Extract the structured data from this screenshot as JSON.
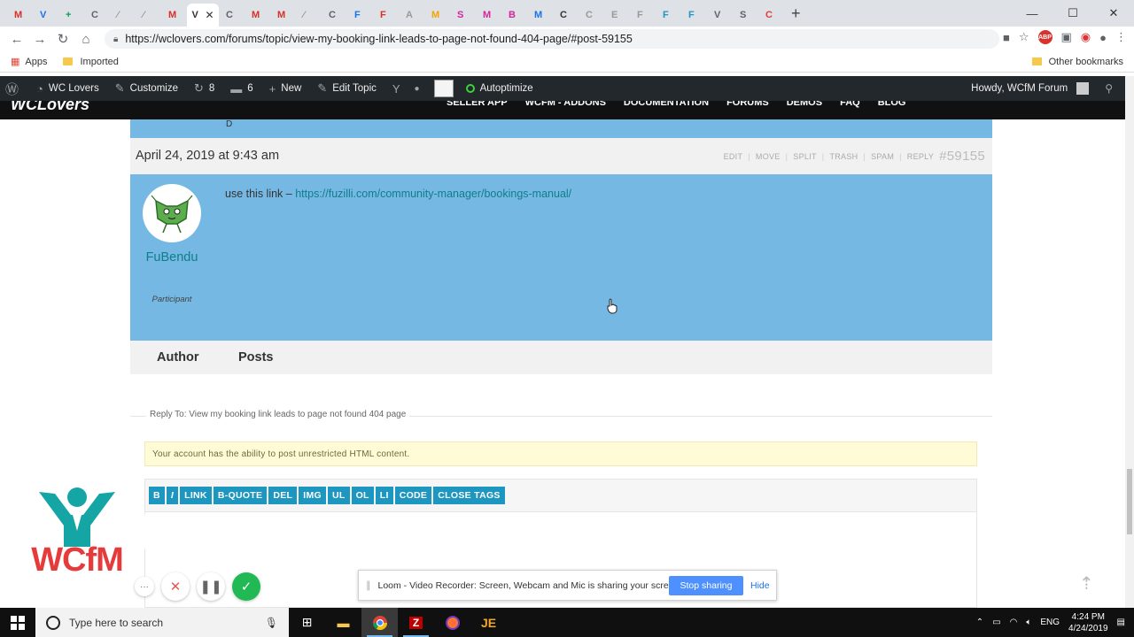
{
  "browser": {
    "url": "https://wclovers.com/forums/topic/view-my-booking-link-leads-to-page-not-found-404-page/#post-59155",
    "bookmarks": {
      "apps": "Apps",
      "imported": "Imported",
      "other": "Other bookmarks"
    },
    "tab_glyphs": [
      "M",
      "V",
      "+",
      "C",
      "⁄",
      "⁄",
      "M",
      "V",
      "C",
      "M",
      "M",
      "⁄",
      "C",
      "F",
      "F",
      "A",
      "M",
      "S",
      "M",
      "B",
      "M",
      "C",
      "C",
      "E",
      "F",
      "F",
      "F",
      "V",
      "S",
      "C"
    ]
  },
  "adminbar": {
    "site": "WC Lovers",
    "customize": "Customize",
    "updates": "8",
    "comments": "6",
    "new": "New",
    "edit_topic": "Edit Topic",
    "autoptimize": "Autoptimize",
    "howdy": "Howdy, WCfM Forum"
  },
  "site_header": {
    "logo": "WCLovers",
    "nav": [
      "SELLER APP",
      "WCFM - ADDONS",
      "DOCUMENTATION",
      "FORUMS",
      "DEMOS",
      "FAQ",
      "BLOG"
    ]
  },
  "reply": {
    "date": "April 24, 2019 at 9:43 am",
    "actions": [
      "EDIT",
      "MOVE",
      "SPLIT",
      "TRASH",
      "SPAM",
      "REPLY"
    ],
    "permalink": "#59155",
    "author": "FuBendu",
    "role": "Participant",
    "text_prefix": "use this link – ",
    "link": "https://fuzilli.com/community-manager/bookings-manual/"
  },
  "footer": {
    "author": "Author",
    "posts": "Posts"
  },
  "reply_form": {
    "legend": "Reply To: View my booking link leads to page not found 404 page",
    "notice": "Your account has the ability to post unrestricted HTML content.",
    "quicktags": [
      "B",
      "I",
      "LINK",
      "B-QUOTE",
      "DEL",
      "IMG",
      "UL",
      "OL",
      "LI",
      "CODE",
      "CLOSE TAGS"
    ]
  },
  "wcfm_widget": {
    "text": "WCfM"
  },
  "loom": {
    "message": "Loom - Video Recorder: Screen, Webcam and Mic is sharing your screen.",
    "stop": "Stop sharing",
    "hide": "Hide"
  },
  "taskbar": {
    "search_placeholder": "Type here to search",
    "lang": "ENG",
    "time": "4:24 PM",
    "date": "4/24/2019"
  },
  "colors": {
    "post_bg": "#75b8e3",
    "accent": "#0e7e8a",
    "quicktag": "#1e97c0",
    "wcfm_red": "#e53b3b",
    "wcfm_teal": "#15a5a5"
  }
}
